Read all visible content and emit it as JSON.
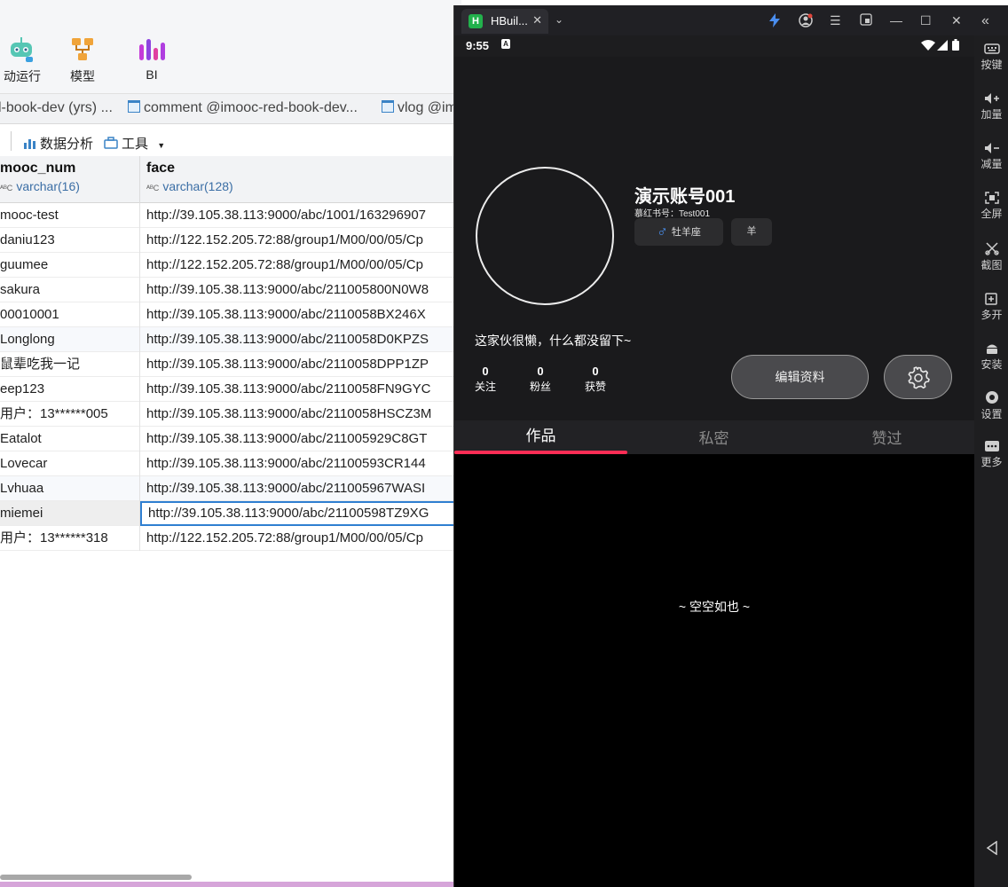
{
  "db": {
    "toolbar": [
      {
        "label": "动运行",
        "icon": "robot-icon"
      },
      {
        "label": "模型",
        "icon": "model-icon"
      },
      {
        "label": "BI",
        "icon": "bi-icon"
      }
    ],
    "tabs": [
      "l-book-dev (yrs) ...",
      "comment @imooc-red-book-dev...",
      "vlog @im"
    ],
    "tools": {
      "analysis": "数据分析",
      "tools": "工具"
    },
    "columns": [
      {
        "name": "mooc_num",
        "type": "varchar(16)"
      },
      {
        "name": "face",
        "type": "varchar(128)"
      }
    ],
    "rows": [
      {
        "num": "mooc-test",
        "face": "http://39.105.38.113:9000/abc/1001/163296907"
      },
      {
        "num": "daniu123",
        "face": "http://122.152.205.72:88/group1/M00/00/05/Cp"
      },
      {
        "num": "guumee",
        "face": "http://122.152.205.72:88/group1/M00/00/05/Cp"
      },
      {
        "num": "sakura",
        "face": "http://39.105.38.113:9000/abc/211005800N0W8"
      },
      {
        "num": "00010001",
        "face": "http://39.105.38.113:9000/abc/2110058BX246X"
      },
      {
        "num": "Longlong",
        "face": "http://39.105.38.113:9000/abc/2110058D0KPZS"
      },
      {
        "num": "鼠辈吃我一记",
        "face": "http://39.105.38.113:9000/abc/2110058DPP1ZP"
      },
      {
        "num": "eep123",
        "face": "http://39.105.38.113:9000/abc/2110058FN9GYC"
      },
      {
        "num": "用户：13******005",
        "face": "http://39.105.38.113:9000/abc/2110058HSCZ3M"
      },
      {
        "num": "Eatalot",
        "face": "http://39.105.38.113:9000/abc/211005929C8GT"
      },
      {
        "num": "Lovecar",
        "face": "http://39.105.38.113:9000/abc/21100593CR144"
      },
      {
        "num": "Lvhuaa",
        "face": "http://39.105.38.113:9000/abc/211005967WASI"
      },
      {
        "num": "miemei",
        "face": "http://39.105.38.113:9000/abc/21100598TZ9XG"
      },
      {
        "num": "用户：13******318",
        "face": "http://122.152.205.72:88/group1/M00/00/05/Cp"
      }
    ]
  },
  "emulator": {
    "tab_title": "HBuil...",
    "side": [
      "按键",
      "加量",
      "减量",
      "全屏",
      "截图",
      "多开",
      "安装",
      "设置",
      "更多"
    ]
  },
  "phone": {
    "time": "9:55",
    "nickname": "演示账号001",
    "redbook_id": "慕红书号：Test001",
    "zodiac": "牡羊座",
    "gender_icon": "male-icon",
    "chinese_zodiac": "羊",
    "bio": "这家伙很懒，什么都没留下~",
    "stats": [
      {
        "num": "0",
        "label": "关注"
      },
      {
        "num": "0",
        "label": "粉丝"
      },
      {
        "num": "0",
        "label": "获赞"
      }
    ],
    "edit_profile": "编辑资料",
    "tabs": [
      "作品",
      "私密",
      "赞过"
    ],
    "active_tab": "作品",
    "empty": "~ 空空如也 ~",
    "accent": "#ff2d55"
  }
}
